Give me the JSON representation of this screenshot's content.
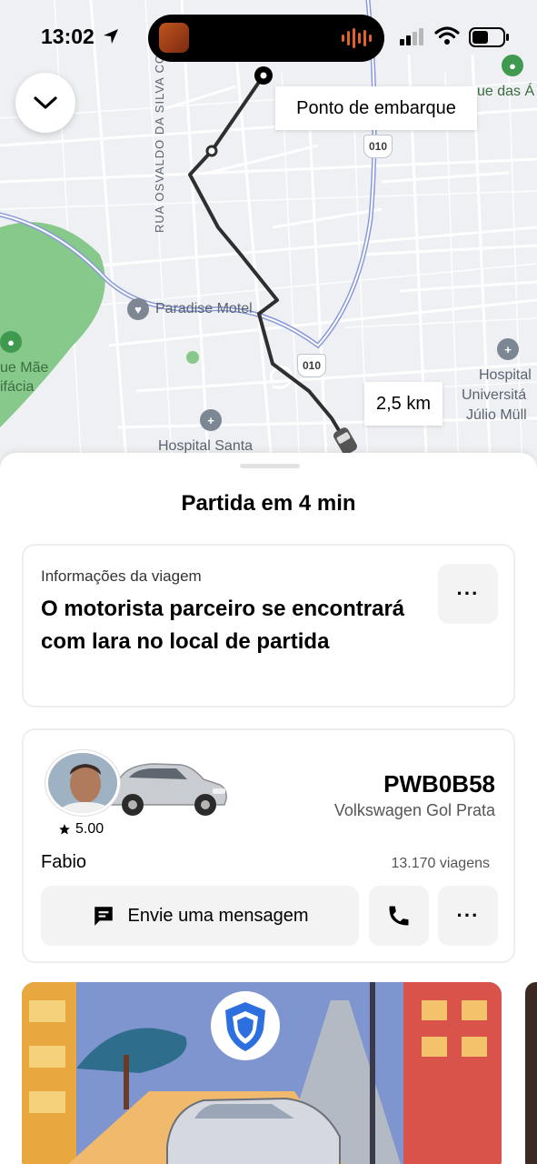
{
  "status_bar": {
    "time": "13:02"
  },
  "map": {
    "pickup_label": "Ponto de embarque",
    "distance": "2,5 km",
    "street": "RUA OSVALDO DA SILVA CORREA",
    "road_number": "010",
    "places": {
      "motel": "Paradise Motel",
      "park_line1": "ue Mãe",
      "park_line2": "ifácia",
      "hospital_santa": "Hospital Santa",
      "hospital_univ_line1": "Hospital",
      "hospital_univ_line2": "Universitá",
      "hospital_univ_line3": "Júlio Müll",
      "top_right": "ue das Á"
    },
    "colors": {
      "route": "#2f2f2f",
      "highway": "#8a9ad8",
      "park": "#86c98a",
      "poi": "#7c8793"
    }
  },
  "sheet": {
    "title": "Partida em 4 min",
    "trip_info": {
      "label": "Informações da viagem",
      "message": "O motorista parceiro se encontrará com lara no local de partida",
      "more": "···"
    },
    "driver": {
      "name": "Fabio",
      "rating": "5.00",
      "plate": "PWB0B58",
      "car": "Volkswagen Gol Prata",
      "trips": "13.170 viagens",
      "message_button": "Envie uma mensagem",
      "more": "···"
    }
  },
  "icons": {
    "collapse": "chevron-down-icon",
    "location_arrow": "location-arrow-icon",
    "signal": "cellular-signal-icon",
    "wifi": "wifi-icon",
    "battery": "battery-icon",
    "star": "star-icon",
    "message": "message-icon",
    "phone": "phone-icon",
    "shield": "shield-icon"
  }
}
